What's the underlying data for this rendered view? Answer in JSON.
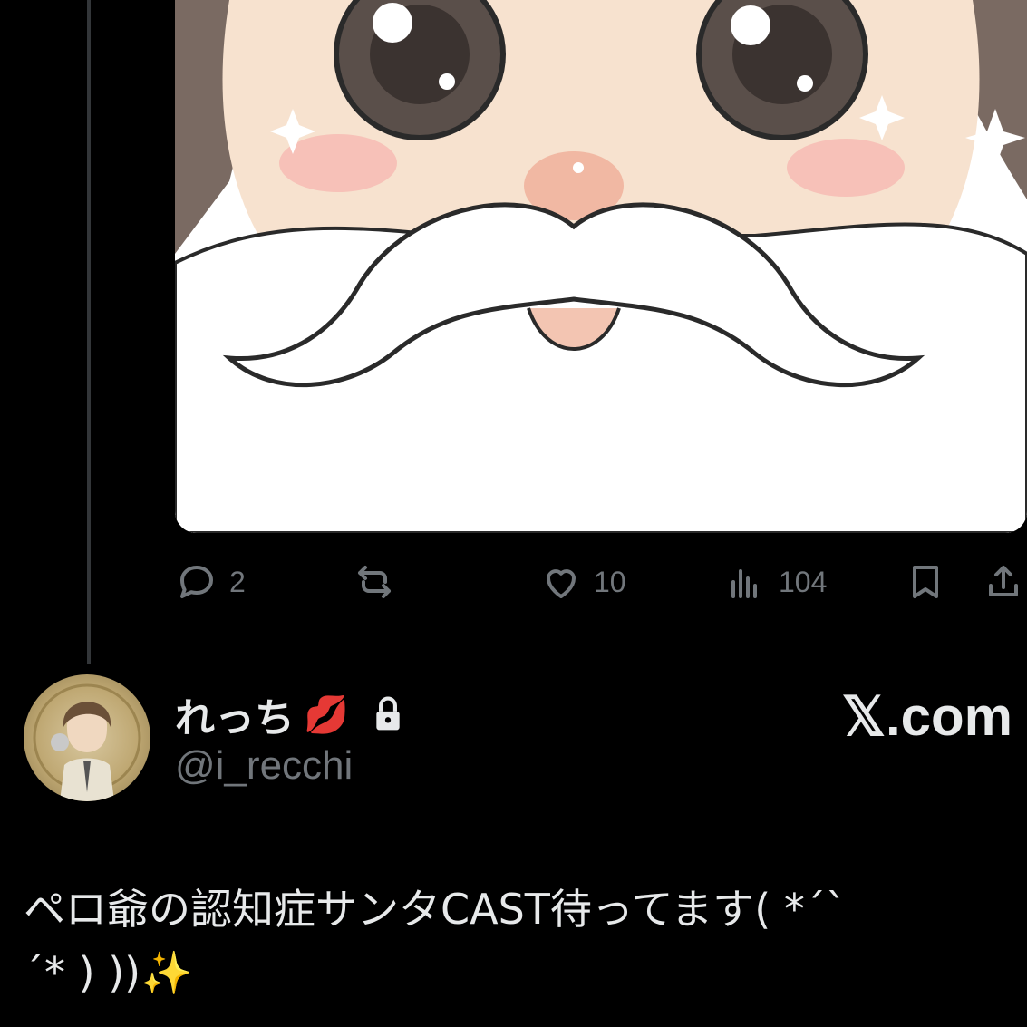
{
  "tweet_actions": {
    "reply_count": "2",
    "retweet_count": "",
    "like_count": "10",
    "views_count": "104"
  },
  "author": {
    "display_name": "れっち",
    "name_emoji": "💋",
    "handle": "@i_recchi",
    "protected_icon": "lock-icon"
  },
  "brand": "𝕏.com",
  "tweet": {
    "text": "ペロ爺の認知症サンタCAST待ってます( *ˊˋ\nˊ* ) ))✨"
  },
  "colors": {
    "background": "#000000",
    "text_primary": "#e7e9ea",
    "text_secondary": "#71767b",
    "thread_line": "#333639"
  }
}
